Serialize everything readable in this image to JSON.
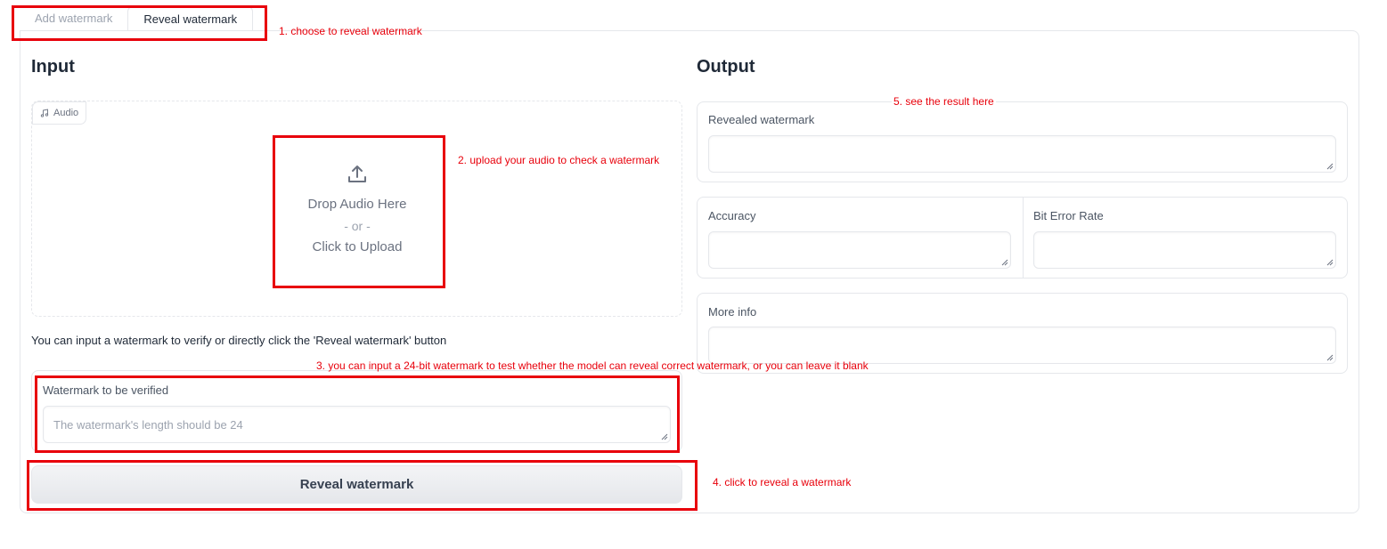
{
  "tabs": [
    {
      "label": "Add watermark"
    },
    {
      "label": "Reveal watermark"
    }
  ],
  "input": {
    "heading": "Input",
    "audio_badge": "Audio",
    "upload": {
      "line1": "Drop Audio Here",
      "line2": "- or -",
      "line3": "Click to Upload"
    },
    "info_text": "You can input a watermark to verify or directly click the 'Reveal watermark' button",
    "verify": {
      "label": "Watermark to be verified",
      "placeholder": "The watermark's length should be 24"
    },
    "button_label": "Reveal watermark"
  },
  "output": {
    "heading": "Output",
    "revealed_label": "Revealed watermark",
    "accuracy_label": "Accuracy",
    "ber_label": "Bit Error Rate",
    "more_info_label": "More info"
  },
  "annotations": {
    "a1": "1. choose to reveal watermark",
    "a2": "2. upload your audio to check a watermark",
    "a3": "3. you can input a 24-bit watermark to test whether the model can reveal correct watermark, or you can leave it blank",
    "a4": "4. click to reveal a watermark",
    "a5": "5. see the result here"
  },
  "colors": {
    "annotation": "#e8000b",
    "border": "#e5e7eb"
  }
}
